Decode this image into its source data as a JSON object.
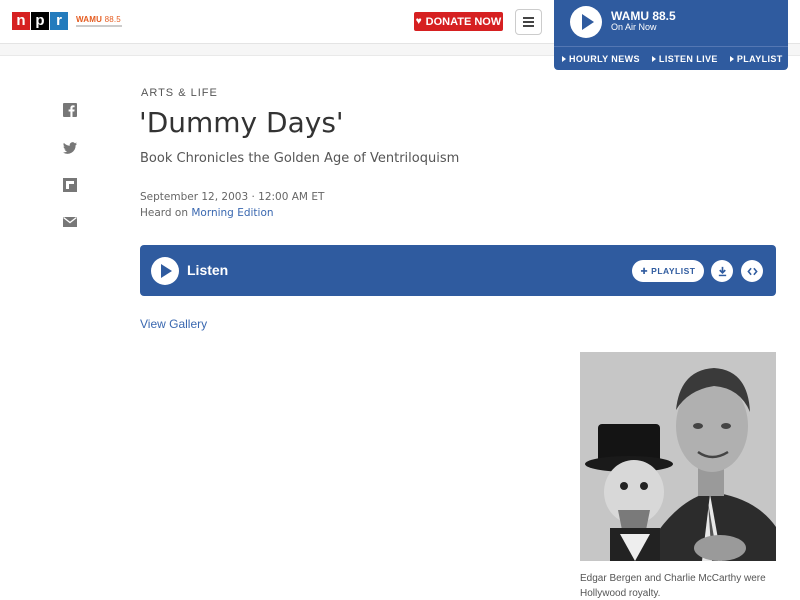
{
  "header": {
    "logo_letters": [
      "n",
      "p",
      "r"
    ],
    "station_name": "WAMU",
    "station_freq": "88.5",
    "donate_label": "DONATE NOW",
    "menu_icon": "hamburger-icon"
  },
  "player": {
    "station": "WAMU 88.5",
    "status": "On Air Now",
    "links": [
      "HOURLY NEWS",
      "LISTEN LIVE",
      "PLAYLIST"
    ]
  },
  "share": {
    "icons": [
      "facebook-icon",
      "twitter-icon",
      "flipboard-icon",
      "email-icon"
    ]
  },
  "article": {
    "slug": "ARTS & LIFE",
    "title": "'Dummy Days'",
    "subtitle": "Book Chronicles the Golden Age of Ventriloquism",
    "date": "September 12, 2003 · 12:00 AM ET",
    "heard_prefix": "Heard on ",
    "heard_program": "Morning Edition"
  },
  "audio": {
    "listen_label": "Listen",
    "playlist_label": "PLAYLIST",
    "download_icon": "download-icon",
    "embed_icon": "embed-icon"
  },
  "gallery": {
    "link_label": "View Gallery",
    "caption": "Edgar Bergen and Charlie McCarthy were Hollywood royalty."
  },
  "colors": {
    "npr_red": "#d62021",
    "npr_black": "#000000",
    "npr_blue": "#237bbd",
    "station_orange": "#e55b1f",
    "player_blue": "#2f5b9f",
    "link_blue": "#3a68b0"
  }
}
